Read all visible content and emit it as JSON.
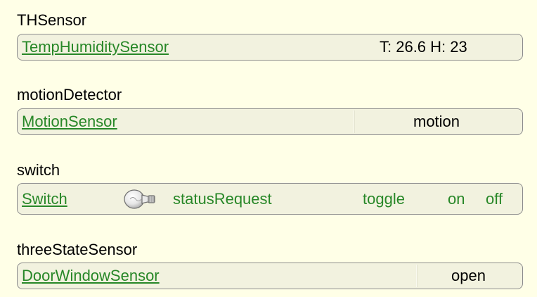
{
  "groups": [
    {
      "title": "THSensor",
      "device": "TempHumiditySensor",
      "state": "T: 26.6 H: 23"
    },
    {
      "title": "motionDetector",
      "device": "MotionSensor",
      "state": "motion"
    },
    {
      "title": "switch",
      "device": "Switch",
      "icon": "light-bulb-icon",
      "commands": {
        "status_request": "statusRequest",
        "toggle": "toggle",
        "on": "on",
        "off": "off"
      }
    },
    {
      "title": "threeStateSensor",
      "device": "DoorWindowSensor",
      "state": "open"
    }
  ]
}
